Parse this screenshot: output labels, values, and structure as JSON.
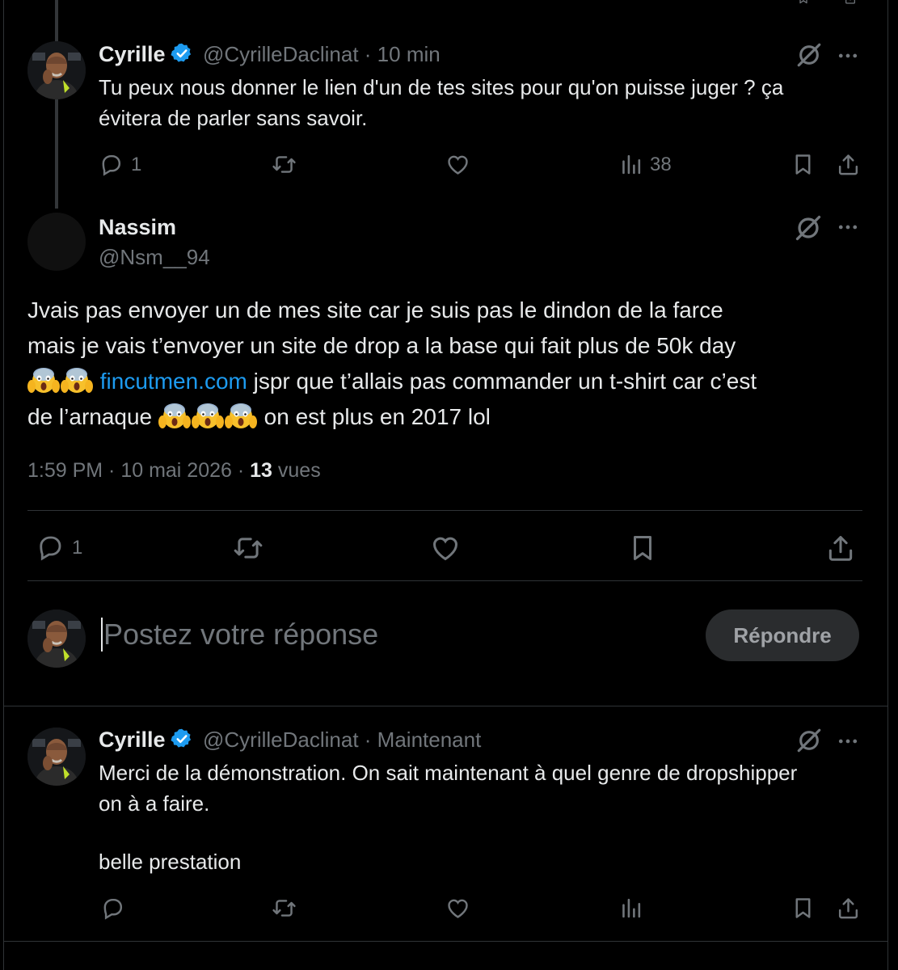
{
  "tweet1": {
    "name": "Cyrille",
    "handle": "@CyrilleDaclinat",
    "time": "10 min",
    "line1": "Tu peux nous donner le lien d'un de tes sites pour qu'on puisse juger ? ça",
    "line2": "évitera de parler sans savoir.",
    "replies": "1",
    "views": "38"
  },
  "tweet2": {
    "name": "Nassim",
    "handle": "@Nsm__94",
    "line1": "Jvais pas envoyer un de mes  site car je suis pas le dindon de la farce",
    "line2": "mais je vais t’envoyer un site de drop a la base qui fait plus de 50k day",
    "link": "fincutmen.com",
    "line3_rest": " jspr que t’allais pas commander un t-shirt car c’est",
    "line4_start": "de l’arnaque ",
    "line4_end": " on est plus en 2017 lol",
    "timestamp": "1:59 PM · 10 mai 2026 · ",
    "views_count": "13",
    "views_label": " vues",
    "replies": "1"
  },
  "composer": {
    "placeholder": "Postez votre réponse",
    "button": "Répondre"
  },
  "tweet3": {
    "name": "Cyrille",
    "handle": "@CyrilleDaclinat",
    "time": "Maintenant",
    "line1": "Merci de la démonstration. On sait maintenant à quel genre de dropshipper",
    "line2": "on à a faire.",
    "line3": "belle prestation"
  },
  "colors": {
    "accent": "#1d9bf0",
    "muted": "#71767b",
    "text": "#e7e9ea",
    "bg": "#000000"
  }
}
